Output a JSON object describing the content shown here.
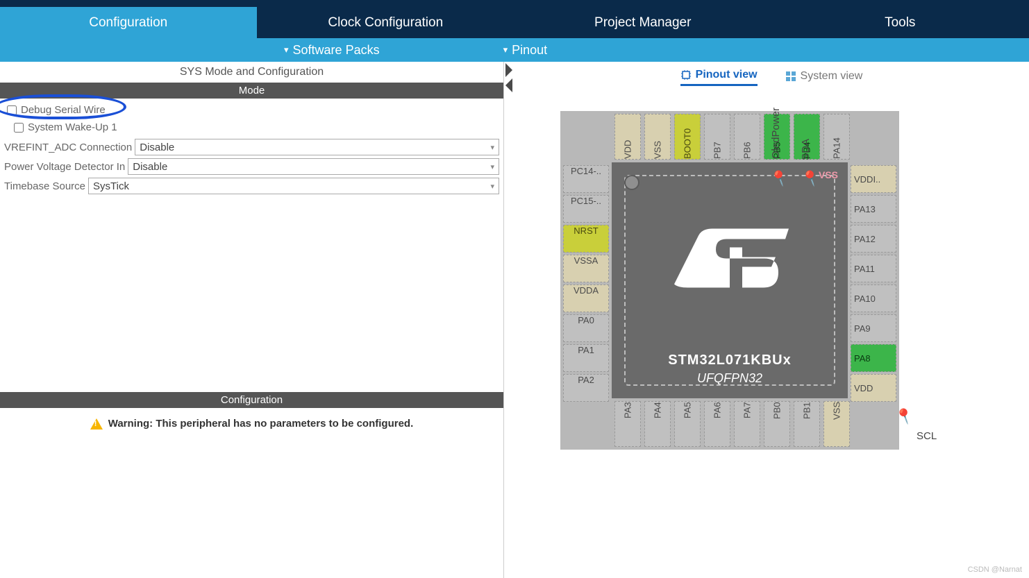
{
  "tabs": {
    "config": "Configuration",
    "clock": "Clock Configuration",
    "pm": "Project Manager",
    "tools": "Tools"
  },
  "subtabs": {
    "softpacks": "Software Packs",
    "pinout": "Pinout"
  },
  "panel": {
    "title": "SYS Mode and Configuration",
    "mode": "Mode",
    "debug": "Debug Serial Wire",
    "wake": "System Wake-Up 1",
    "vref_label": "VREFINT_ADC Connection",
    "vref_val": "Disable",
    "pvd_label": "Power Voltage Detector In",
    "pvd_val": "Disable",
    "tb_label": "Timebase Source",
    "tb_val": "SysTick",
    "config": "Configuration",
    "warning": "Warning: This peripheral has no parameters to be configured."
  },
  "views": {
    "pinout": "Pinout view",
    "system": "System view"
  },
  "chip": {
    "name": "STM32L071KBUx",
    "pkg": "UFQFPN32",
    "vss": "VSS"
  },
  "pins": {
    "top": [
      "VDD",
      "VSS",
      "BOOT0",
      "PB7",
      "PB6",
      "PB5",
      "PB4",
      "PA14"
    ],
    "right": [
      "VDDI..",
      "PA13",
      "PA12",
      "PA11",
      "PA10",
      "PA9",
      "PA8",
      "VDD"
    ],
    "bottom": [
      "PA3",
      "PA4",
      "PA5",
      "PA6",
      "PA7",
      "PB0",
      "PB1",
      "VSS"
    ],
    "left": [
      "PC14-..",
      "PC15-..",
      "NRST",
      "VSSA",
      "VDDA",
      "PA0",
      "PA1",
      "PA2"
    ]
  },
  "labels": {
    "oled": "OledPower",
    "sda": "SDA",
    "scl": "SCL"
  },
  "watermark": "CSDN @Narnat"
}
